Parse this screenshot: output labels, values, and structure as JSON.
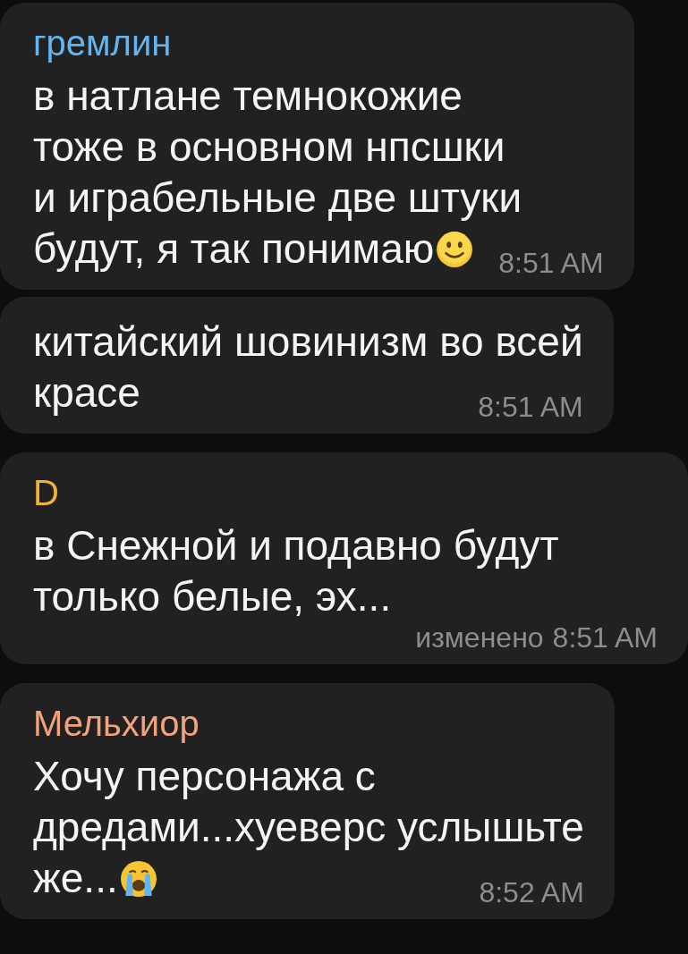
{
  "messages": [
    {
      "sender": "гремлин",
      "color": "#64b5ef",
      "text": "в натлане темнокожие\nтоже в основном нпсшки\nи играбельные две штуки\nбудут, я так понимаю",
      "icons": [
        {
          "kind": "slight-smile"
        }
      ],
      "time": "8:51 AM"
    },
    {
      "text": "китайский шовинизм во всей\nкрасе",
      "time": "8:51 AM"
    },
    {
      "sender": "D",
      "color": "#f2b233",
      "text": "в Снежной и подавно будут\nтолько белые, эх...",
      "edited_label": "изменено",
      "time": "8:51 AM"
    },
    {
      "sender": "Мельхиор",
      "color": "#f3a27c",
      "text": "Хочу персонажа с\nдредами...хуеверс услышьте\nже...",
      "icons": [
        {
          "kind": "crying"
        }
      ],
      "time": "8:52 AM"
    }
  ]
}
